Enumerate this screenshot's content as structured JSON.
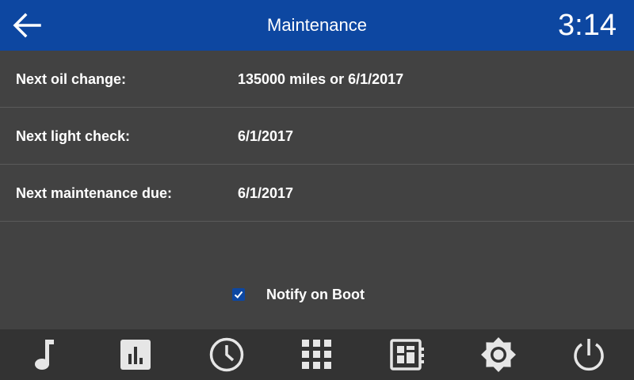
{
  "header": {
    "title": "Maintenance",
    "clock": "3:14",
    "back_icon": "arrow-left-icon",
    "color": "#0d47a1"
  },
  "rows": [
    {
      "label": "Next oil change:",
      "value": "135000 miles or 6/1/2017"
    },
    {
      "label": "Next light check:",
      "value": "6/1/2017"
    },
    {
      "label": "Next maintenance due:",
      "value": "6/1/2017"
    }
  ],
  "notify": {
    "label": "Notify on Boot",
    "checked": true
  },
  "nav": [
    {
      "icon": "music-note-icon"
    },
    {
      "icon": "bar-chart-icon"
    },
    {
      "icon": "clock-icon"
    },
    {
      "icon": "apps-grid-icon"
    },
    {
      "icon": "dashboard-icon"
    },
    {
      "icon": "brightness-icon"
    },
    {
      "icon": "power-icon"
    }
  ],
  "colors": {
    "background": "#424242",
    "nav_bar": "#333333",
    "accent": "#0d47a1",
    "icon": "#e6e6e6"
  }
}
